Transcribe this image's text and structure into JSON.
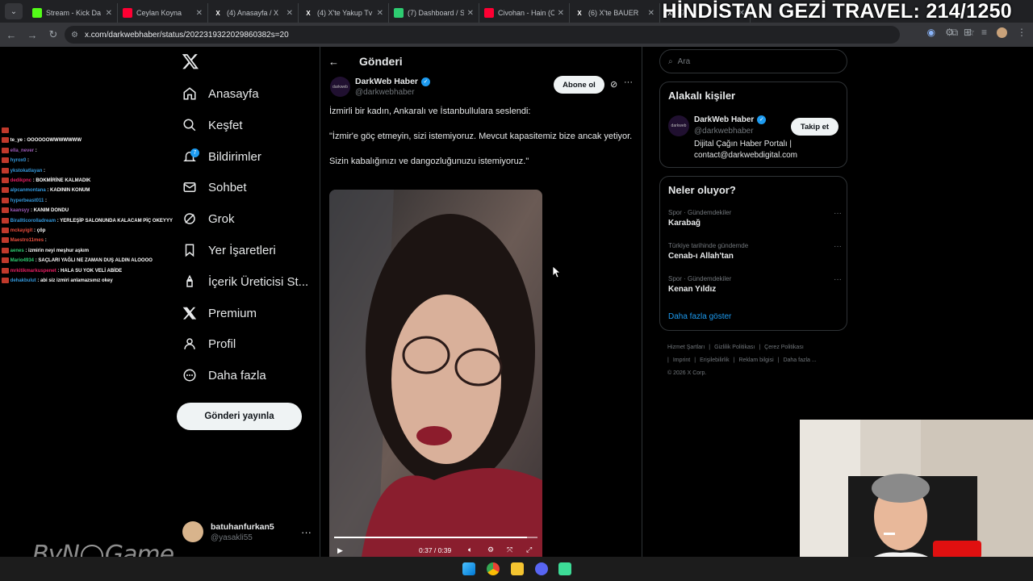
{
  "browser": {
    "tabs": [
      {
        "title": "Stream - Kick Da",
        "icon": "kick-icon",
        "color": "#53fc18"
      },
      {
        "title": "Ceylan Koyna",
        "icon": "youtube-icon",
        "color": "#ff0033"
      },
      {
        "title": "(4) Anasayfa / X",
        "icon": "x-icon",
        "color": "#ffffff"
      },
      {
        "title": "(4) X'te Yakup Tv",
        "icon": "x-icon",
        "color": "#ffffff"
      },
      {
        "title": "(7) Dashboard / S",
        "icon": "dashboard-icon",
        "color": "#2ecc71"
      },
      {
        "title": "Civohan - Hain (C",
        "icon": "youtube-icon",
        "color": "#ff0033"
      },
      {
        "title": "(6) X'te BAUER ",
        "icon": "x-icon",
        "color": "#ffffff"
      },
      {
        "title": "(7)",
        "icon": "x-icon",
        "color": "#ffffff"
      }
    ],
    "url": "x.com/darkwebhaber/status/2022319322029860382s=20"
  },
  "overlay": {
    "title": "HİNDİSTAN GEZİ TRAVEL: 214/1250",
    "logo_text": "ByN Game"
  },
  "chat": [
    {
      "user": "",
      "msg": "",
      "color": "#ff4d4d"
    },
    {
      "user": "te_ye",
      "msg": ": OOOOOOWWWWWWW",
      "color": "#ffffff"
    },
    {
      "user": "ella_never",
      "msg": ":",
      "color": "#9b59b6"
    },
    {
      "user": "hyrox0",
      "msg": ":",
      "color": "#3498db"
    },
    {
      "user": "ykstokatlayan",
      "msg": ":",
      "color": "#3498db"
    },
    {
      "user": "dedikpnc",
      "msg": ": BOKMİRİNE KALMADIK",
      "color": "#e91e63"
    },
    {
      "user": "alpcanmontana",
      "msg": ": KADININ KONUM",
      "color": "#3498db"
    },
    {
      "user": "hyperbeast011",
      "msg": ":",
      "color": "#3498db"
    },
    {
      "user": "kaansyy",
      "msg": ": KANIM DONDU",
      "color": "#9b59b6"
    },
    {
      "user": "Birallticorolladream",
      "msg": ": YERLEŞİP SALONUNDA KALACAM PİÇ OKEYYY",
      "color": "#3498db"
    },
    {
      "user": "mckayigit",
      "msg": ": çöp",
      "color": "#e74c3c"
    },
    {
      "user": "Maestro11mes",
      "msg": ":",
      "color": "#e74c3c"
    },
    {
      "user": "aenes",
      "msg": ": izmirin neyi meşhur aşkım",
      "color": "#2ecc71"
    },
    {
      "user": "Mario4934",
      "msg": ": SAÇLARI YAĞLI NE ZAMAN DUŞ ALDIN ALOOOO",
      "color": "#2ecc71"
    },
    {
      "user": "mrkitikmarkuspenet",
      "msg": ": HALA SU YOK VELİ ABİDE",
      "color": "#e91e63"
    },
    {
      "user": "dehakbulut",
      "msg": ": abi siz izmiri anlamazsınız okey",
      "color": "#3498db"
    }
  ],
  "nav": {
    "items": [
      {
        "label": "Anasayfa",
        "icon": "home-icon"
      },
      {
        "label": "Keşfet",
        "icon": "search-icon"
      },
      {
        "label": "Bildirimler",
        "icon": "bell-icon"
      },
      {
        "label": "Sohbet",
        "icon": "mail-icon"
      },
      {
        "label": "Grok",
        "icon": "grok-icon"
      },
      {
        "label": "Yer İşaretleri",
        "icon": "bookmark-icon"
      },
      {
        "label": "İçerik Üreticisi St...",
        "icon": "creator-icon"
      },
      {
        "label": "Premium",
        "icon": "x-premium-icon"
      },
      {
        "label": "Profil",
        "icon": "profile-icon"
      },
      {
        "label": "Daha fazla",
        "icon": "more-circle-icon"
      }
    ],
    "notification_count": "7",
    "post_button": "Gönderi yayınla",
    "account": {
      "name": "batuhanfurkan5",
      "handle": "@yasakli55"
    }
  },
  "main": {
    "header_title": "Gönderi",
    "post": {
      "author": "DarkWeb Haber",
      "handle": "@darkwebhaber",
      "avatar_text": "darkweb",
      "subscribe": "Abone ol",
      "paragraphs": [
        "İzmirli bir kadın, Ankaralı ve İstanbullulara seslendi:",
        "\"İzmir'e göç etmeyin, sizi istemiyoruz. Mevcut kapasitemiz bize ancak yetiyor.",
        "Sizin kabalığınızı ve dangozluğunuzu istemiyoruz.\""
      ],
      "video": {
        "time": "0:37 / 0:39",
        "progress": 0.95
      }
    }
  },
  "right": {
    "search_placeholder": "Ara",
    "related": {
      "title": "Alakalı kişiler",
      "name": "DarkWeb Haber",
      "handle": "@darkwebhaber",
      "bio": "Dijital Çağın Haber Portalı | contact@darkwebdigital.com",
      "follow": "Takip et"
    },
    "trends": {
      "title": "Neler oluyor?",
      "items": [
        {
          "context": "Spor · Gündemdekiler",
          "name": "Karabağ"
        },
        {
          "context": "Türkiye tarihinde gündemde",
          "name": "Cenab-ı Allah'tan"
        },
        {
          "context": "Spor · Gündemdekiler",
          "name": "Kenan Yıldız"
        }
      ],
      "show_more": "Daha fazla göster"
    },
    "footer": [
      "Hizmet Şartları",
      "|",
      "Gizlilik Politikası",
      "|",
      "Çerez Politikası",
      "|",
      "Imprint",
      "|",
      "Erişilebilirlik",
      "|",
      "Reklam bilgisi",
      "|",
      "Daha fazla ...",
      "© 2026 X Corp."
    ]
  }
}
